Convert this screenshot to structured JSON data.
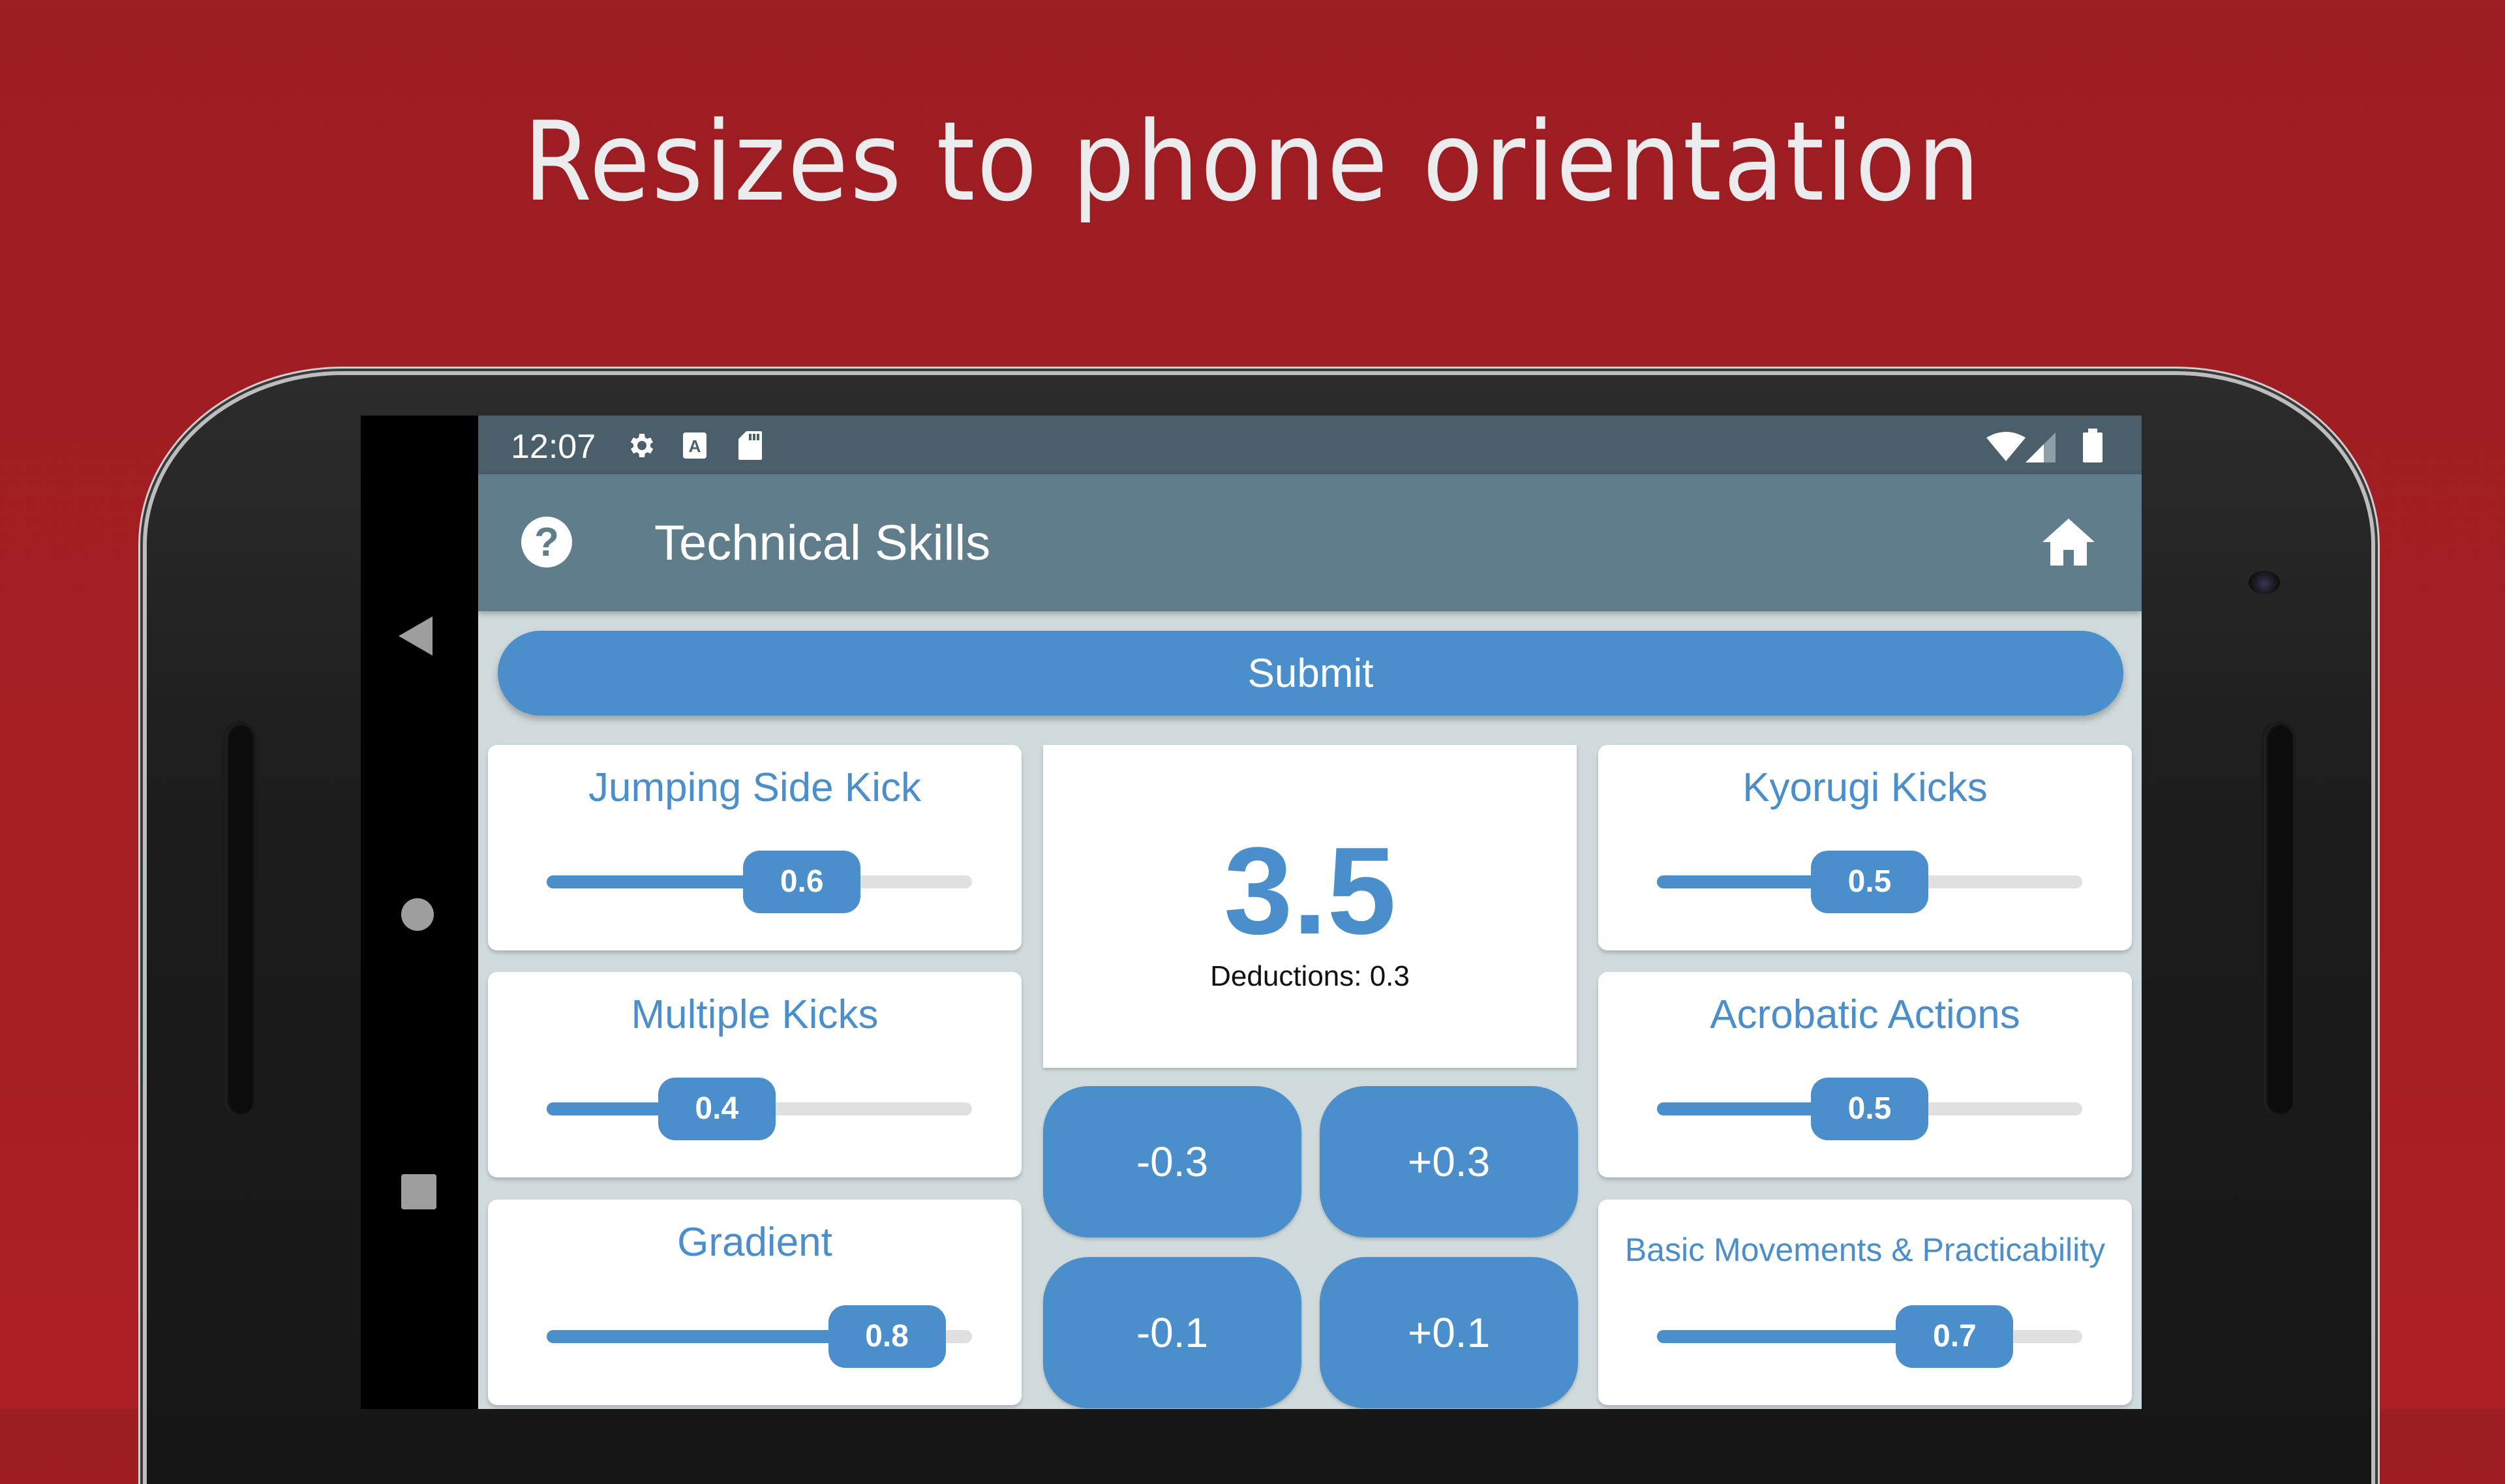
{
  "headline": "Resizes to phone orientation",
  "status_bar": {
    "time": "12:07",
    "left_icons": [
      "gear-icon",
      "font-a-icon",
      "sd-card-icon"
    ],
    "right_icons": [
      "wifi-icon",
      "signal-icon",
      "battery-icon"
    ]
  },
  "app_bar": {
    "title": "Technical Skills",
    "help_icon": "?",
    "home_icon": "home-icon"
  },
  "submit_label": "Submit",
  "colors": {
    "accent": "#4a8ecb",
    "app_bar": "#607d8b",
    "status_bar": "#4b5f6b",
    "background": "#cfdadd",
    "page_background": "#a51e24"
  },
  "score": {
    "value": "3.5",
    "deductions_label": "Deductions: 0.3"
  },
  "adjust_buttons": [
    {
      "label": "-0.3"
    },
    {
      "label": "+0.3"
    },
    {
      "label": "-0.1"
    },
    {
      "label": "+0.1"
    }
  ],
  "sliders": [
    {
      "label": "Jumping Side Kick",
      "value": 0.6,
      "display": "0.6"
    },
    {
      "label": "Multiple Kicks",
      "value": 0.4,
      "display": "0.4"
    },
    {
      "label": "Gradient",
      "value": 0.8,
      "display": "0.8"
    },
    {
      "label": "Kyorugi Kicks",
      "value": 0.5,
      "display": "0.5"
    },
    {
      "label": "Acrobatic Actions",
      "value": 0.5,
      "display": "0.5"
    },
    {
      "label": "Basic Movements & Practicability",
      "value": 0.7,
      "display": "0.7"
    }
  ],
  "slider_range": [
    0,
    1
  ]
}
